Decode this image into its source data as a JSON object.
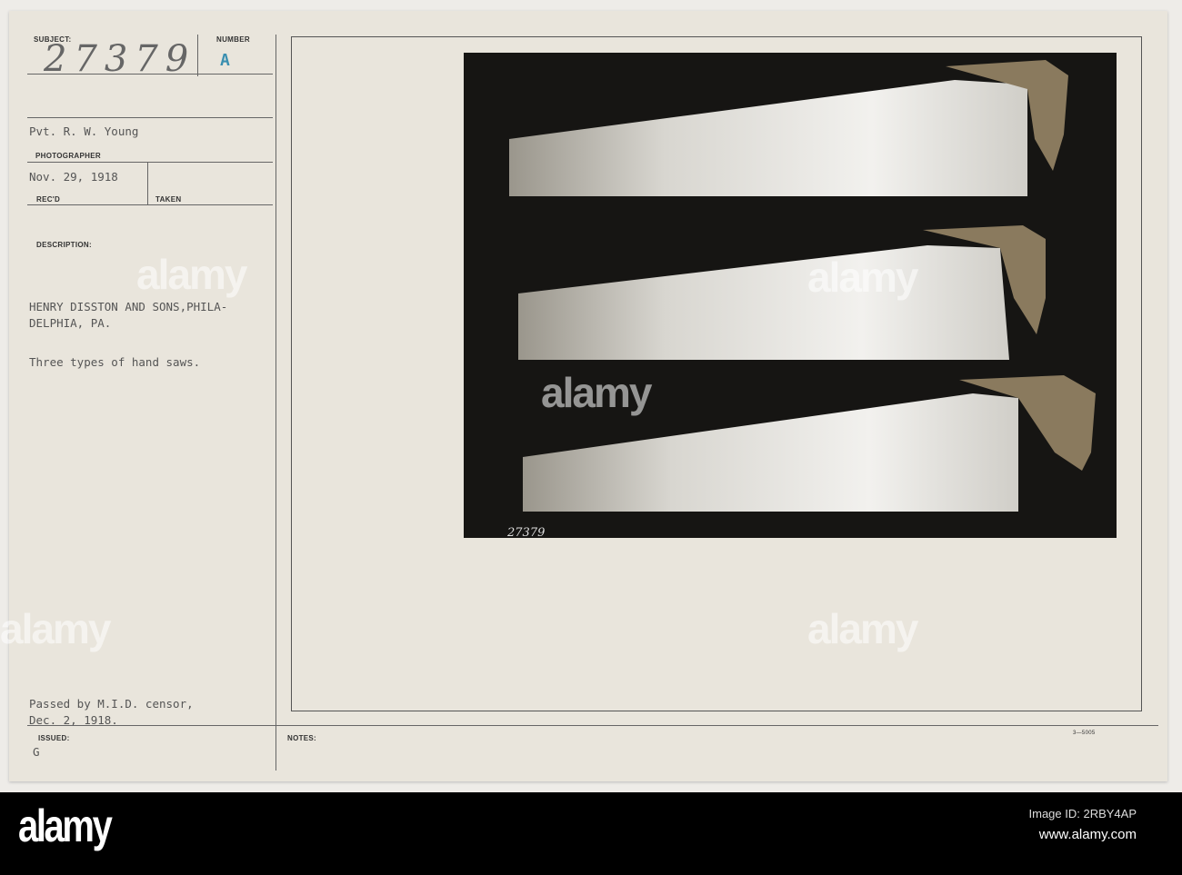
{
  "card": {
    "subject_label": "SUBJECT:",
    "subject_number": "27379",
    "number_label": "NUMBER",
    "number_value": "A",
    "photographer": "Pvt. R. W. Young",
    "photographer_label": "PHOTOGRAPHER",
    "received_date": "Nov. 29, 1918",
    "received_label": "REC'D",
    "taken_label": "TAKEN",
    "description_label": "DESCRIPTION:",
    "description_line1": "HENRY DISSTON AND SONS,PHILA-",
    "description_line2": "DELPHIA, PA.",
    "description_line3": "Three types of hand saws.",
    "censor_line1": "Passed by M.I.D. censor,",
    "censor_line2": "Dec. 2, 1918.",
    "issued_label": "ISSUED:",
    "issued_value": "G",
    "notes_label": "NOTES:",
    "form_number": "3—5005",
    "photo_number": "27379",
    "number_color": "#3a8fb0"
  },
  "watermark": {
    "text": "alamy",
    "image_id": "Image ID: 2RBY4AP",
    "url": "www.alamy.com"
  }
}
